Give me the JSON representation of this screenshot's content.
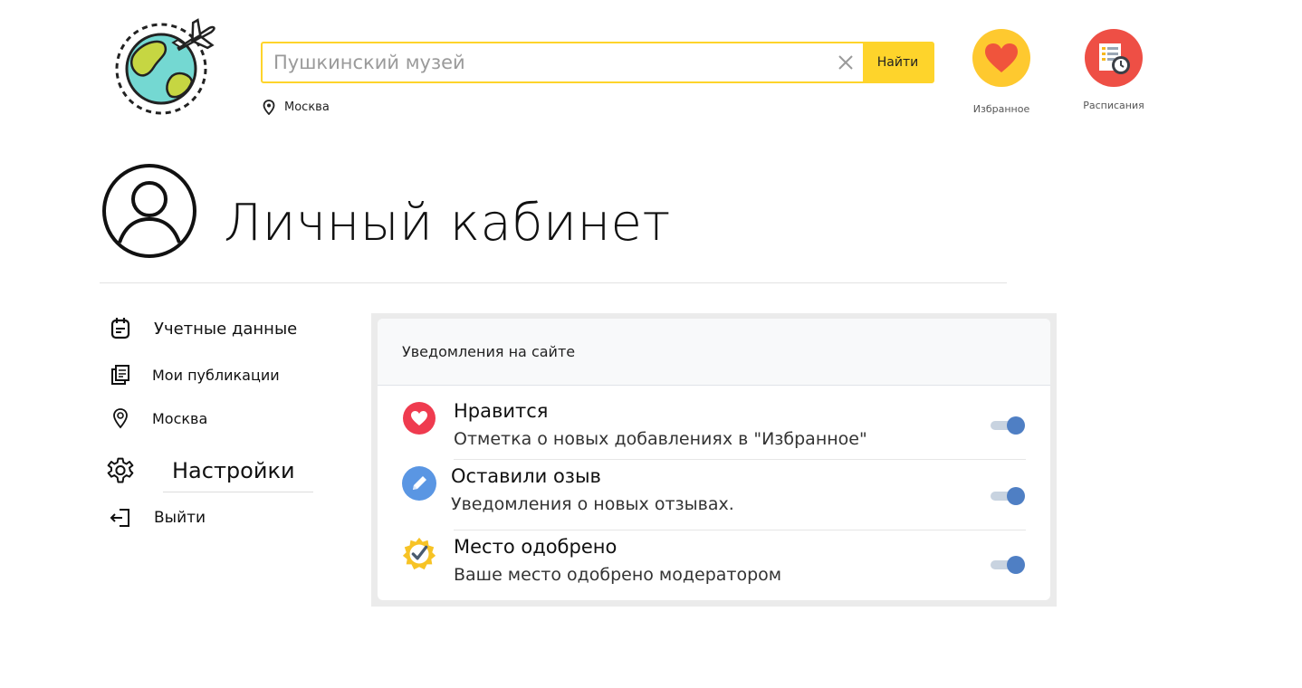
{
  "header": {
    "search": {
      "placeholder": "Пушкинский музей",
      "button_label": "Найти"
    },
    "location": "Москва",
    "quick_links": [
      {
        "label": "Избранное",
        "icon": "heart-icon"
      },
      {
        "label": "Расписания",
        "icon": "schedule-icon"
      }
    ]
  },
  "page": {
    "title": "Личный кабинет"
  },
  "sidebar": {
    "items": [
      {
        "label": "Учетные данные",
        "icon": "account-data-icon"
      },
      {
        "label": "Мои публикации",
        "icon": "publications-icon"
      },
      {
        "label": "Москва",
        "icon": "location-pin-icon"
      },
      {
        "label": "Настройки",
        "icon": "gear-icon"
      },
      {
        "label": "Выйти",
        "icon": "logout-icon"
      }
    ]
  },
  "notifications": {
    "header": "Уведомления на сайте",
    "items": [
      {
        "title": "Нравится",
        "description": "Отметка о новых добавлениях в \"Избранное\"",
        "enabled": true
      },
      {
        "title": "Оставили озыв",
        "description": "Уведомления о новых отзывах.",
        "enabled": true
      },
      {
        "title": "Место одобрено",
        "description": "Ваше место одобрено модератором",
        "enabled": true
      }
    ]
  },
  "colors": {
    "accent": "#fed42b",
    "toggle_on": "#4f7fc4",
    "heart_red": "#ef3b4f",
    "edit_blue": "#5a96e3",
    "badge_yellow": "#f7c325"
  }
}
